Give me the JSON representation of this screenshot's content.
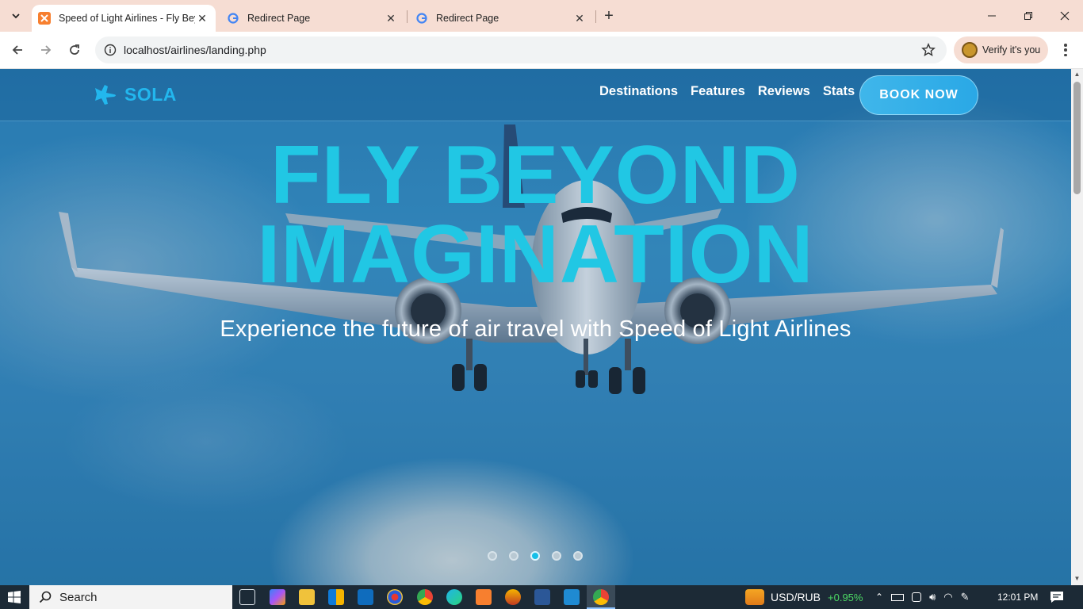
{
  "browser": {
    "tabs": [
      {
        "title": "Speed of Light Airlines - Fly Bey",
        "active": true
      },
      {
        "title": "Redirect Page",
        "active": false
      },
      {
        "title": "Redirect Page",
        "active": false
      }
    ],
    "url": "localhost/airlines/landing.php",
    "verify_label": "Verify it's you"
  },
  "site": {
    "brand": "SOLA",
    "nav": [
      "Destinations",
      "Features",
      "Reviews",
      "Stats"
    ],
    "cta": "BOOK NOW",
    "hero": {
      "line1": "FLY BEYOND",
      "line2": "IMAGINATION",
      "subtitle": "Experience the future of air travel with Speed of Light Airlines"
    },
    "carousel": {
      "count": 5,
      "active_index": 2
    }
  },
  "taskbar": {
    "search_label": "Search",
    "ticker_pair": "USD/RUB",
    "ticker_change": "+0.95%",
    "time": "12:01 PM"
  },
  "colors": {
    "accent": "#21c7e4",
    "brand": "#22b7ee",
    "ticker_up": "#4cd964"
  }
}
